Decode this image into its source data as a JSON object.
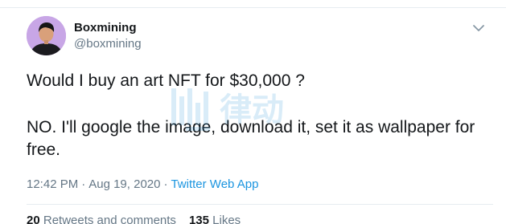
{
  "tweet": {
    "display_name": "Boxmining",
    "handle": "@boxmining",
    "text_line1": "Would I buy an art NFT for $30,000 ?",
    "text_line2": "NO. I'll google the image, download it, set it as wallpaper for free.",
    "time": "12:42 PM",
    "separator": "·",
    "date": "Aug 19, 2020",
    "source": "Twitter Web App",
    "retweets_count": "20",
    "retweets_label": "Retweets and comments",
    "likes_count": "135",
    "likes_label": "Likes"
  },
  "icons": {
    "avatar": "avatar",
    "menu_caret": "chevron-down-icon",
    "watermark": "律动"
  },
  "colors": {
    "text_primary": "#14171a",
    "text_secondary": "#657786",
    "link": "#1b95e0",
    "divider": "#e6ecf0",
    "avatar_bg": "#c8a6e6"
  }
}
